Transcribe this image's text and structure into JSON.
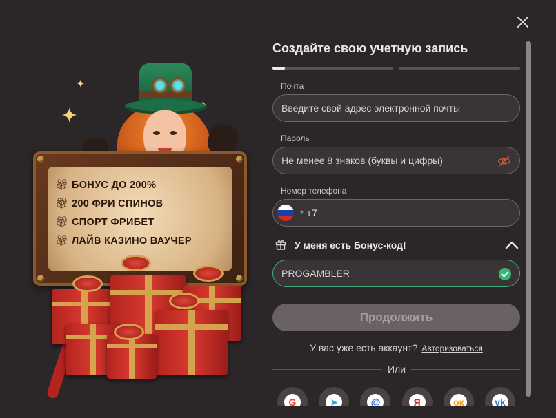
{
  "modal": {
    "title": "Создайте свою учетную запись",
    "steps": {
      "current": 1,
      "total": 2,
      "step1_progress": 0.1
    }
  },
  "promo_banner": {
    "lines": [
      "БОНУС ДО 200%",
      "200 ФРИ СПИНОВ",
      "СПОРТ ФРИБЕТ",
      "ЛАЙВ КАЗИНО ВАУЧЕР"
    ]
  },
  "form": {
    "email": {
      "label": "Почта",
      "placeholder": "Введите свой адрес электронной почты"
    },
    "password": {
      "label": "Пароль",
      "placeholder": "Не менее 8 знаков (буквы и цифры)"
    },
    "phone": {
      "label": "Номер телефона",
      "country_code": "+7",
      "country": "Russia"
    },
    "promo": {
      "toggle_label": "У меня есть Бонус-код!",
      "value": "PROGAMBLER",
      "valid": true
    },
    "continue_label": "Продолжить",
    "have_account_text": "У вас уже есть аккаунт?",
    "login_link": "Авторизоваться",
    "or_label": "Или"
  },
  "social_providers": [
    {
      "name": "google",
      "glyph": "G",
      "color": "#ea4335"
    },
    {
      "name": "telegram",
      "glyph": "➤",
      "color": "#2aa3df"
    },
    {
      "name": "mail",
      "glyph": "@",
      "color": "#1a6fe0"
    },
    {
      "name": "yandex",
      "glyph": "Я",
      "color": "#e4222c"
    },
    {
      "name": "odnoklassniki",
      "glyph": "ок",
      "color": "#f39a1d"
    },
    {
      "name": "vk",
      "glyph": "vk",
      "color": "#2a80d6"
    }
  ],
  "colors": {
    "background": "#2b2628",
    "input_bg": "#3b3436",
    "valid_green": "#34b779",
    "button_disabled": "#6a6163"
  }
}
